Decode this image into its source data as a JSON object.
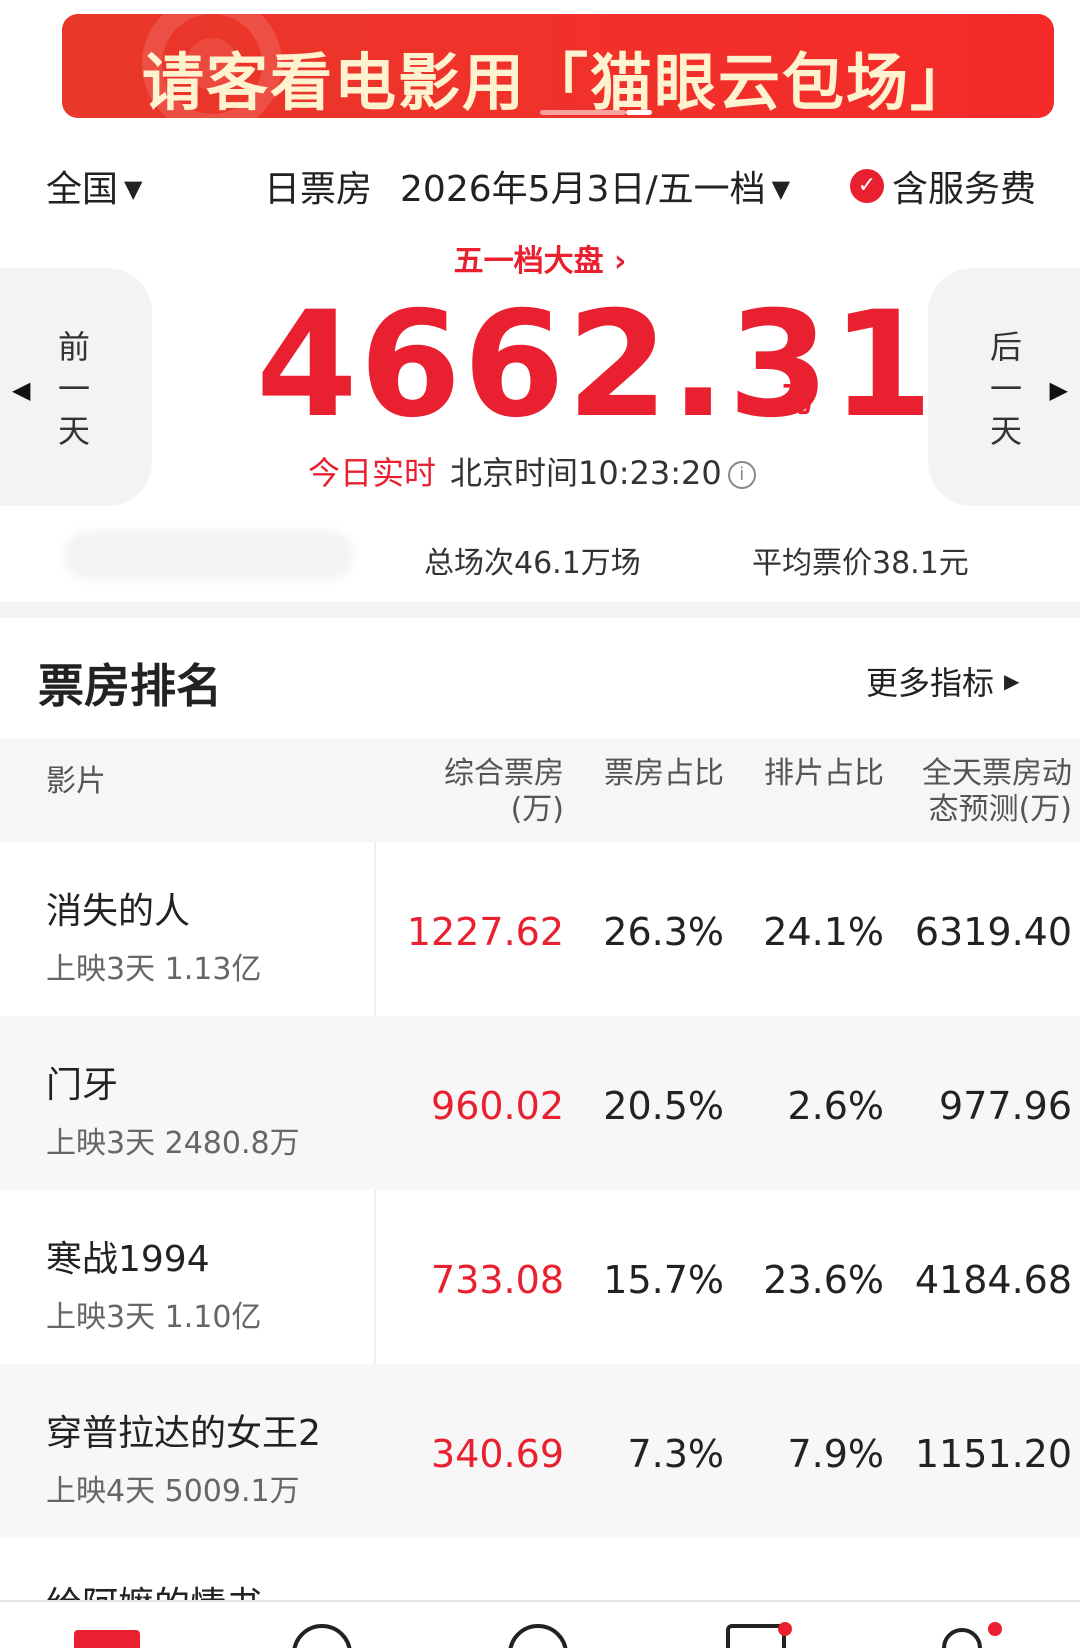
{
  "banner": {
    "text": "请客看电影用「猫眼云包场」"
  },
  "header": {
    "region": "全国",
    "box_label": "日票房",
    "date": "2026年5月3日/五一档",
    "service": "含服务费"
  },
  "nav": {
    "prev_day": [
      "前",
      "一",
      "天"
    ],
    "next_day": [
      "后",
      "一",
      "天"
    ]
  },
  "summary": {
    "holiday_link": "五一档大盘 ›",
    "total": "4662.31",
    "unit": "万",
    "realtime_label": "今日实时",
    "beijing_time": "北京时间10:23:20",
    "shows": "总场次46.1万场",
    "avg_price": "平均票价38.1元"
  },
  "ranking": {
    "title": "票房排名",
    "more": "更多指标",
    "columns": {
      "film": "影片",
      "box": [
        "综合票房",
        "(万)"
      ],
      "box_share": "票房占比",
      "show_share": "排片占比",
      "forecast": [
        "全天票房动",
        "态预测(万)"
      ]
    },
    "rows": [
      {
        "name": "消失的人",
        "sub": "上映3天  1.13亿",
        "box": "1227.62",
        "box_share": "26.3%",
        "show_share": "24.1%",
        "forecast": "6319.40"
      },
      {
        "name": "门牙",
        "sub": "上映3天  2480.8万",
        "box": "960.02",
        "box_share": "20.5%",
        "show_share": "2.6%",
        "forecast": "977.96"
      },
      {
        "name": "寒战1994",
        "sub": "上映3天  1.10亿",
        "box": "733.08",
        "box_share": "15.7%",
        "show_share": "23.6%",
        "forecast": "4184.68"
      },
      {
        "name": "穿普拉达的女王2",
        "sub": "上映4天  5009.1万",
        "box": "340.69",
        "box_share": "7.3%",
        "show_share": "7.9%",
        "forecast": "1151.20"
      }
    ],
    "partial_next": "给阿嬷的情书"
  }
}
